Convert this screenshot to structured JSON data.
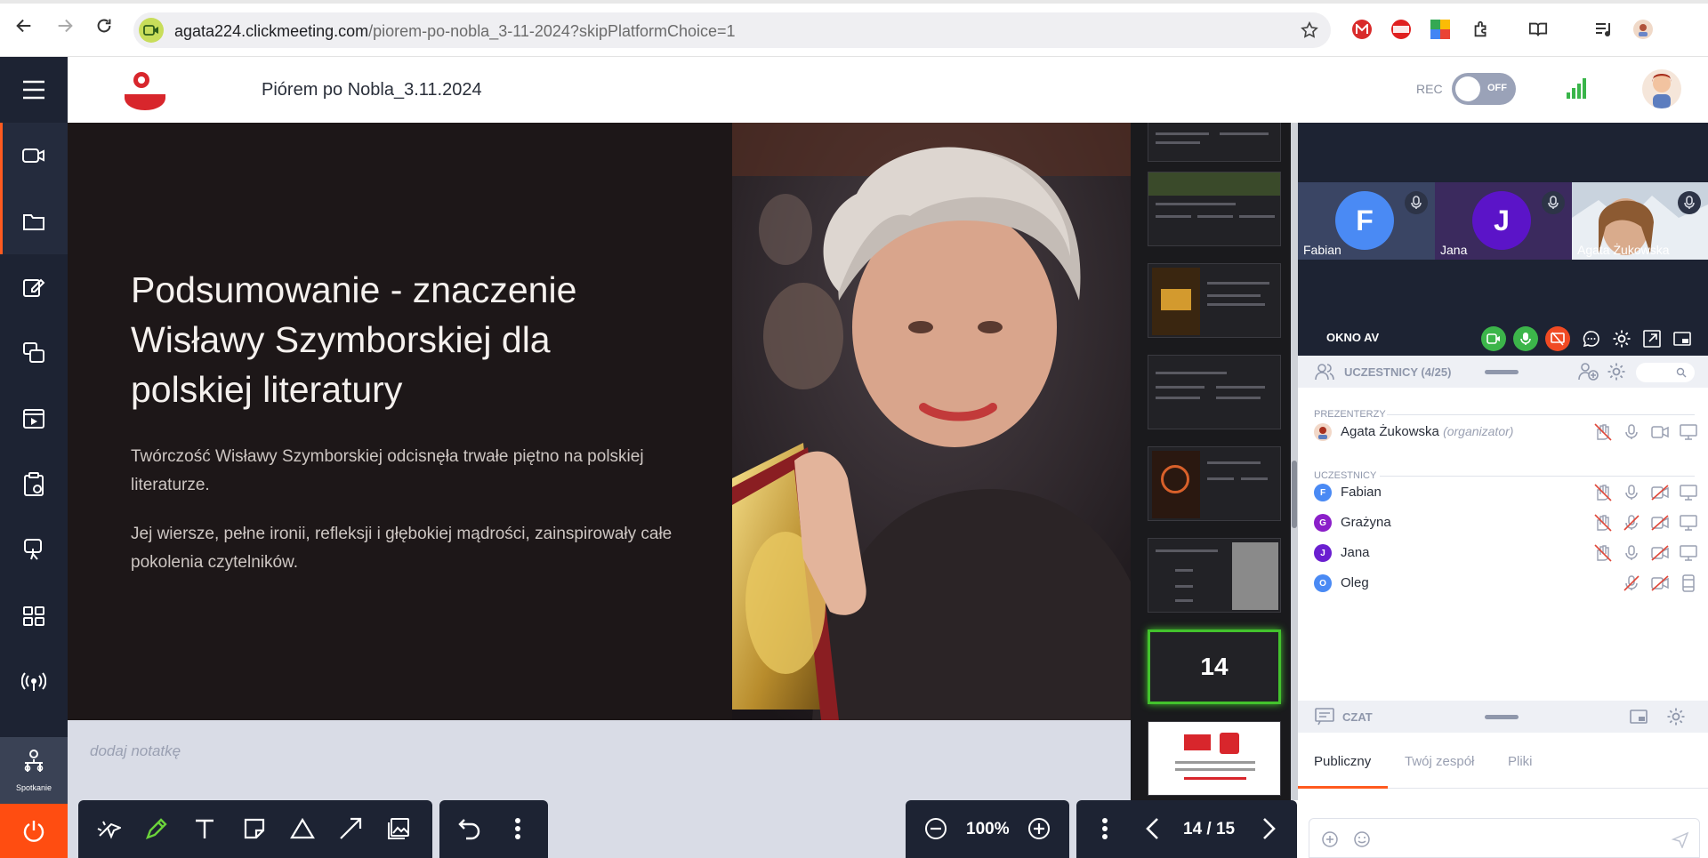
{
  "browser": {
    "url_host": "agata224.clickmeeting.com",
    "url_path": "/piorem-po-nobla_3-11-2024?skipPlatformChoice=1"
  },
  "header": {
    "title": "Piórem po Nobla_3.11.2024",
    "rec_label": "REC",
    "rec_toggle": "OFF"
  },
  "rail": {
    "spotkanie_label": "Spotkanie"
  },
  "slide": {
    "title": "Podsumowanie - znaczenie Wisławy Szymborskiej dla polskiej literatury",
    "p1": "Twórczość Wisławy Szymborskiej odcisnęła trwałe piętno na polskiej literaturze.",
    "p2": "Jej wiersze, pełne ironii, refleksji i głębokiej mądrości, zainspirowały całe pokolenia czytelników."
  },
  "thumbnails": {
    "current_number": "14"
  },
  "notes": {
    "placeholder": "dodaj notatkę"
  },
  "toolbar": {
    "zoom": "100%",
    "page": "14 / 15"
  },
  "video": {
    "tiles": [
      {
        "initial": "F",
        "name": "Fabian"
      },
      {
        "initial": "J",
        "name": "Jana"
      },
      {
        "initial": "",
        "name": "Agata Żukowska"
      }
    ],
    "av_label": "OKNO AV"
  },
  "participants": {
    "header": "UCZESTNICY (4/25)",
    "presenters_label": "PREZENTERZY",
    "participants_label": "UCZESTNICY",
    "presenters": [
      {
        "name": "Agata Żukowska",
        "role": "(organizator)"
      }
    ],
    "list": [
      {
        "initial": "F",
        "name": "Fabian",
        "color": "#4a8af4"
      },
      {
        "initial": "G",
        "name": "Grażyna",
        "color": "#8b1fc9"
      },
      {
        "initial": "J",
        "name": "Jana",
        "color": "#6a1fd0"
      },
      {
        "initial": "O",
        "name": "Oleg",
        "color": "#4a8af4"
      }
    ]
  },
  "chat": {
    "header": "CZAT",
    "tabs": [
      "Publiczny",
      "Twój zespół",
      "Pliki"
    ]
  },
  "colors": {
    "accent": "#ff5a1f",
    "rail": "#1d2333",
    "current_slide_border": "#43c22d"
  }
}
